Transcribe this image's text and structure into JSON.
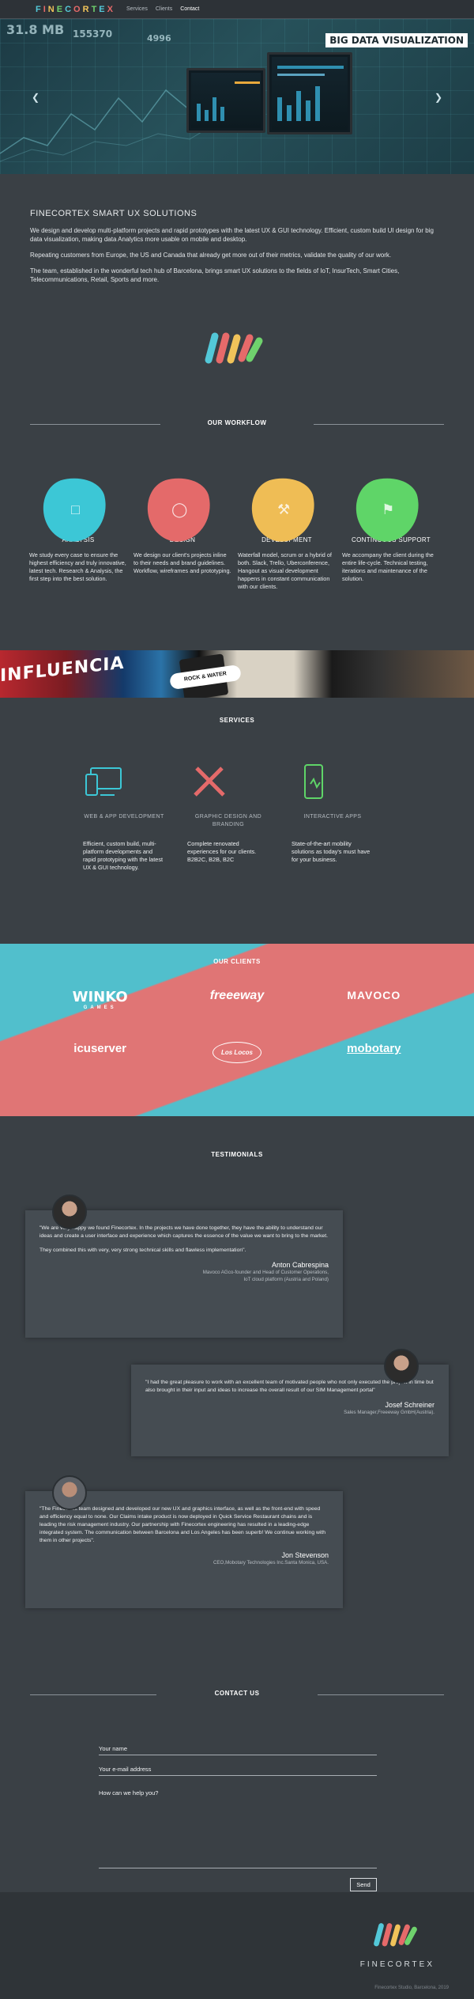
{
  "nav": {
    "logo": "FINECORTEX",
    "logo_colors": [
      "#53c8d8",
      "#e66a6a",
      "#f0c35a",
      "#6fd26d"
    ],
    "links": [
      {
        "label": "Services",
        "active": false
      },
      {
        "label": "Clients",
        "active": false
      },
      {
        "label": "Contact",
        "active": true
      }
    ]
  },
  "hero": {
    "title": "BIG DATA VISUALIZATION",
    "stats": [
      "31.8 MB",
      "155370",
      "4996"
    ],
    "prev_icon": "chevron-left-icon",
    "next_icon": "chevron-right-icon"
  },
  "intro": {
    "heading": "FINECORTEX SMART UX SOLUTIONS",
    "paragraphs": [
      "We design and develop multi-platform projects and rapid prototypes with the latest UX & GUI technology. Efficient, custom build UI design for big data visualization, making data Analytics more usable on mobile and desktop.",
      "Repeating customers from Europe, the US and Canada that already get more out of their metrics, validate the quality of our work.",
      "The team, established in the wonderful tech hub of Barcelona, brings smart UX solutions to the fields of IoT, InsurTech, Smart Cities, Telecommunications, Retail, Sports and more."
    ]
  },
  "workflow": {
    "title": "OUR WORKFLOW",
    "items": [
      {
        "label": "ANALYSIS",
        "icon": "calendar-icon",
        "color": "#3cc7d6",
        "text": "We study every case to ensure the highest efficiency and truly innovative, latest tech. Research & Analysis, the first step into the best solution."
      },
      {
        "label": "DESIGN",
        "icon": "lightbulb-icon",
        "color": "#e46a6a",
        "text": "We design our client's projects inline to their needs and brand guidelines. Workflow, wireframes and prototyping."
      },
      {
        "label": "DEVELOPMENT",
        "icon": "wrench-icon",
        "color": "#efbd55",
        "text": "Waterfall model, scrum or a hybrid of both. Slack, Trello, Uberconference, Hangout as visual development happens in constant communication with our clients."
      },
      {
        "label": "CONTINUOUS SUPPORT",
        "icon": "flag-icon",
        "color": "#5fd568",
        "text": "We accompany the client during the entire life-cycle. Technical testing, iterations and maintenance of the solution."
      }
    ]
  },
  "banner": {
    "text": "INFLUENCIA",
    "badge": "ROCK & WATER"
  },
  "services": {
    "title": "SERVICES",
    "items": [
      {
        "label": "WEB & APP DEVELOPMENT",
        "icon": "devices-icon",
        "color": "#3cc7d6",
        "text": "Efficient, custom build, multi-platform developments and rapid prototyping with the latest UX & GUI technology."
      },
      {
        "label": "GRAPHIC DESIGN AND BRANDING",
        "icon": "pencil-ruler-icon",
        "color": "#e46a6a",
        "text": "Complete renovated experiences for our clients. B2B2C, B2B, B2C"
      },
      {
        "label": "INTERACTIVE APPS",
        "icon": "phone-touch-icon",
        "color": "#5fd568",
        "text": "State-of-the-art mobility solutions as today's must have for your business."
      }
    ]
  },
  "clients": {
    "title": "OUR CLIENTS",
    "logos": [
      "WINKO",
      "freeeway",
      "MAVOCO",
      "icuserver",
      "Los Locos",
      "mobotary"
    ],
    "winko_sub": "GAMES"
  },
  "testimonials": {
    "title": "TESTIMONIALS",
    "items": [
      {
        "paragraphs": [
          "\"We are very happy we found Finecortex. In the projects we have done together, they have the ability to understand our ideas and create a user interface and experience which captures the essence of the value we want to bring to the market.",
          "They combined this with very, very strong technical skills and flawless implementation\"."
        ],
        "name": "Anton Cabrespina",
        "role_line1": "Mavoco AGco-founder and Head of Customer Operations,",
        "role_line2": "IoT cloud platform (Austria and Poland)"
      },
      {
        "paragraphs": [
          "\"I had the great pleasure to work with an excellent team of motivated people who not only executed the project in time but also brought in their input and ideas to increase the overall result of our SIM Management portal\""
        ],
        "name": "Josef Schreiner",
        "role_line1": "Sales Manager,Freeeway GmbH(Austria).",
        "role_line2": ""
      },
      {
        "paragraphs": [
          "\"The Finecortex team designed and developed our new UX and graphics interface, as well as the front-end with speed and efficiency equal to none. Our Claims intake product is now deployed in Quick Service Restaurant chains and is leading the risk management industry. Our partnership with Finecortex engineering has resulted in a leading-edge integrated system. The communication between Barcelona and Los Angeles has been superb! We continue working with them in other projects\"."
        ],
        "name": "Jon Stevenson",
        "role_line1": "CEO,Mobotary Technologies Inc.Santa Monica, USA.",
        "role_line2": ""
      }
    ]
  },
  "contact": {
    "title": "CONTACT US",
    "name_placeholder": "Your name",
    "email_placeholder": "Your e-mail address",
    "message_placeholder": "How can we help you?",
    "send_label": "Send"
  },
  "footer": {
    "brand": "FINECORTEX",
    "address": "Finecortex Studio, Barcelona, 2019"
  }
}
